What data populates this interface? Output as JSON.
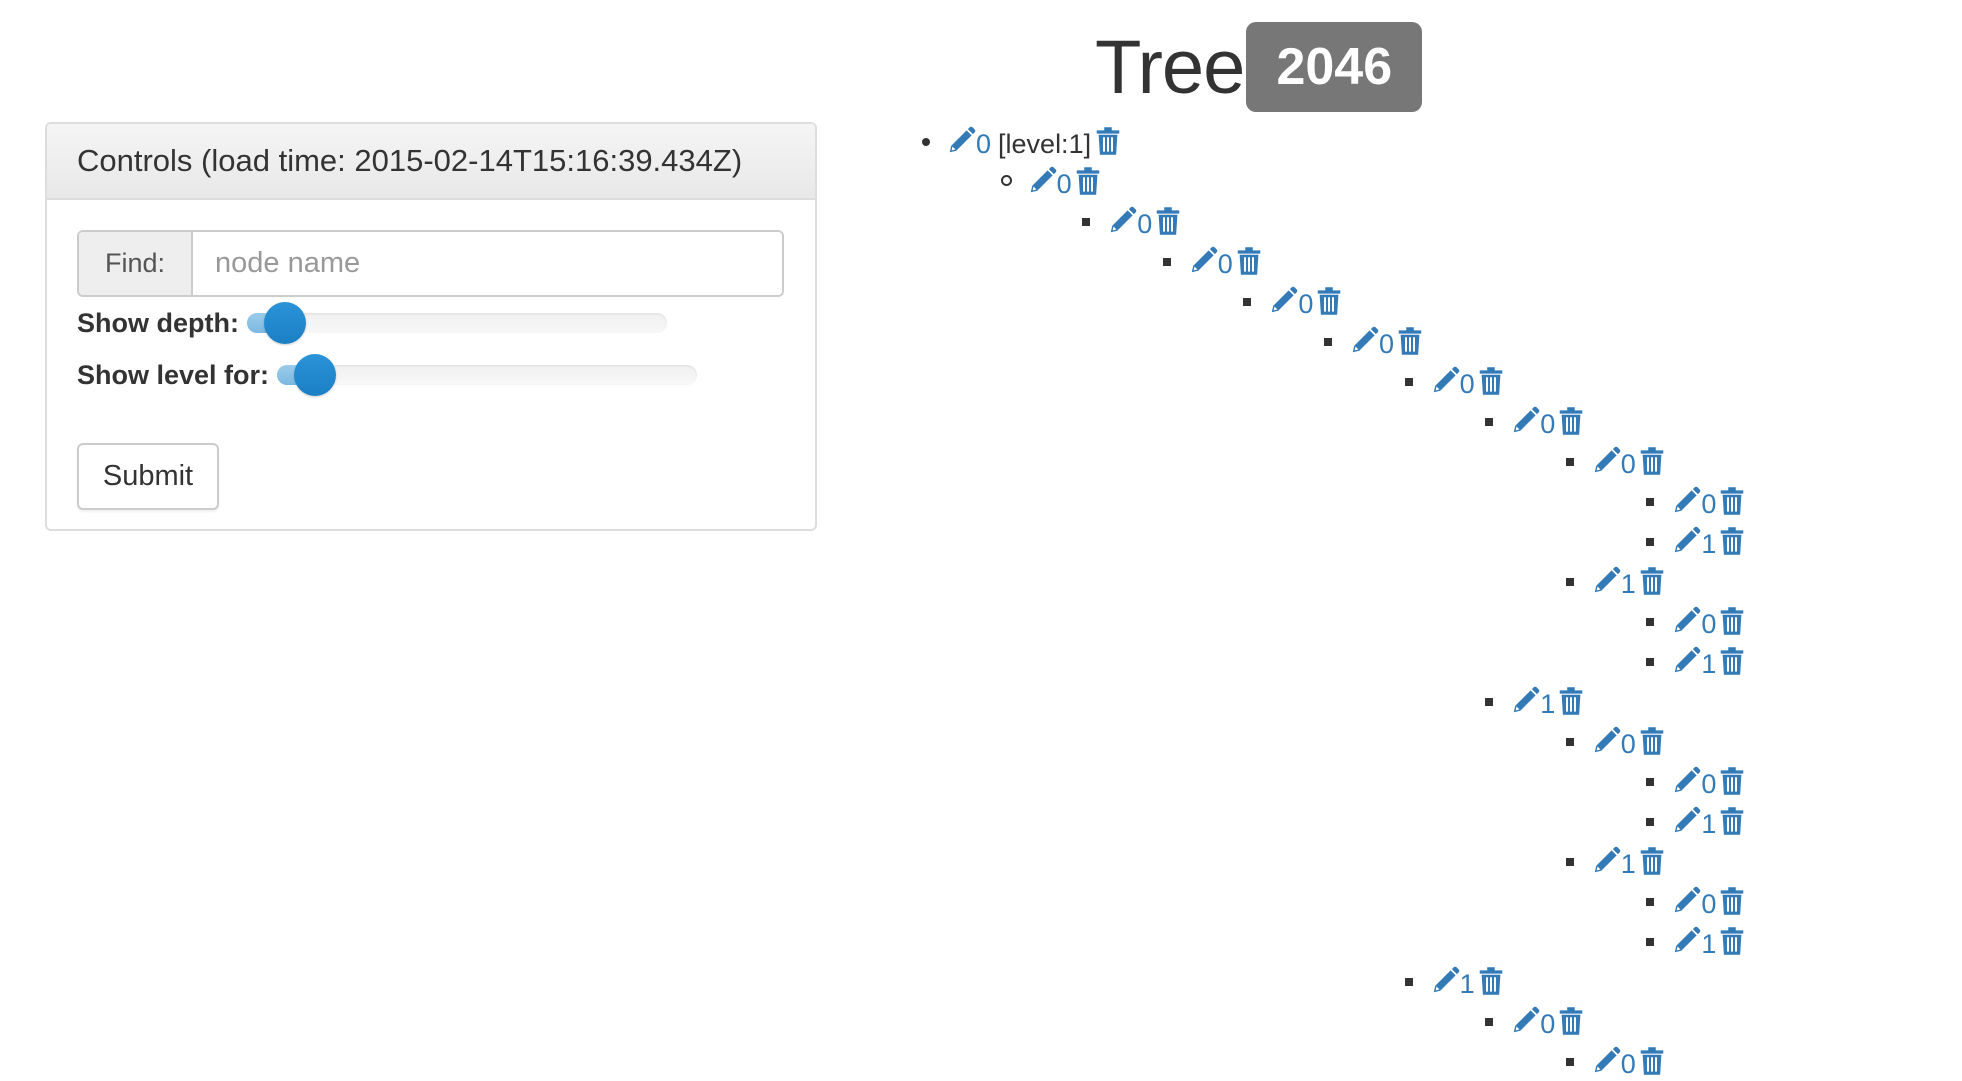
{
  "controls": {
    "heading": "Controls (load time: 2015-02-14T15:16:39.434Z)",
    "find_label": "Find:",
    "find_placeholder": "node name",
    "find_value": "",
    "show_depth_label": "Show depth:",
    "show_depth_fraction": 0.09,
    "show_level_label": "Show level for:",
    "show_level_fraction": 0.09,
    "submit_label": "Submit"
  },
  "title": {
    "text": "Tree",
    "count": "2046"
  },
  "colors": {
    "link": "#337ab7",
    "badge": "#777777",
    "slider_handle": "#1b7fc4"
  },
  "tree": {
    "nodes": [
      {
        "label": "0",
        "depth": 0,
        "bullet": "disc",
        "level_text": "[level:1]"
      },
      {
        "label": "0",
        "depth": 1,
        "bullet": "circle"
      },
      {
        "label": "0",
        "depth": 2,
        "bullet": "square"
      },
      {
        "label": "0",
        "depth": 3,
        "bullet": "square"
      },
      {
        "label": "0",
        "depth": 4,
        "bullet": "square"
      },
      {
        "label": "0",
        "depth": 5,
        "bullet": "square"
      },
      {
        "label": "0",
        "depth": 6,
        "bullet": "square"
      },
      {
        "label": "0",
        "depth": 7,
        "bullet": "square"
      },
      {
        "label": "0",
        "depth": 8,
        "bullet": "square"
      },
      {
        "label": "0",
        "depth": 9,
        "bullet": "square"
      },
      {
        "label": "1",
        "depth": 9,
        "bullet": "square"
      },
      {
        "label": "1",
        "depth": 8,
        "bullet": "square"
      },
      {
        "label": "0",
        "depth": 9,
        "bullet": "square"
      },
      {
        "label": "1",
        "depth": 9,
        "bullet": "square"
      },
      {
        "label": "1",
        "depth": 7,
        "bullet": "square"
      },
      {
        "label": "0",
        "depth": 8,
        "bullet": "square"
      },
      {
        "label": "0",
        "depth": 9,
        "bullet": "square"
      },
      {
        "label": "1",
        "depth": 9,
        "bullet": "square"
      },
      {
        "label": "1",
        "depth": 8,
        "bullet": "square"
      },
      {
        "label": "0",
        "depth": 9,
        "bullet": "square"
      },
      {
        "label": "1",
        "depth": 9,
        "bullet": "square"
      },
      {
        "label": "1",
        "depth": 6,
        "bullet": "square"
      },
      {
        "label": "0",
        "depth": 7,
        "bullet": "square"
      },
      {
        "label": "0",
        "depth": 8,
        "bullet": "square"
      }
    ]
  }
}
